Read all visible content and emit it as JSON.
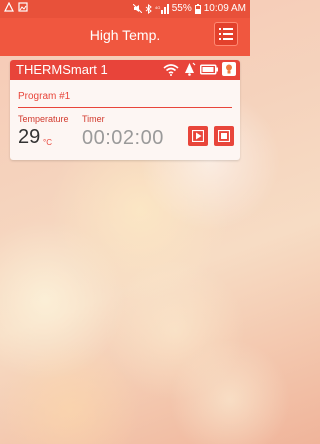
{
  "status_bar": {
    "battery_percent": "55%",
    "time": "10:09 AM",
    "icons": [
      "notification-icon",
      "image-icon",
      "mute-icon",
      "bluetooth-icon",
      "lte-signal-icon",
      "battery-icon"
    ]
  },
  "app_bar": {
    "title": "High Temp.",
    "menu_icon": "list-menu-icon"
  },
  "device_card": {
    "device_name": "THERMSmart 1",
    "header_icons": [
      "wifi-icon",
      "alarm-bell-icon",
      "battery-icon",
      "light-icon"
    ],
    "program_label": "Program #1",
    "temperature_label": "Temperature",
    "timer_label": "Timer",
    "temperature_value": "29",
    "temperature_unit": "°C",
    "timer_value": "00:02:00",
    "play_icon": "play-icon",
    "stop_icon": "stop-icon"
  },
  "colors": {
    "accent": "#e8453a",
    "app_bar": "#f0573f"
  }
}
